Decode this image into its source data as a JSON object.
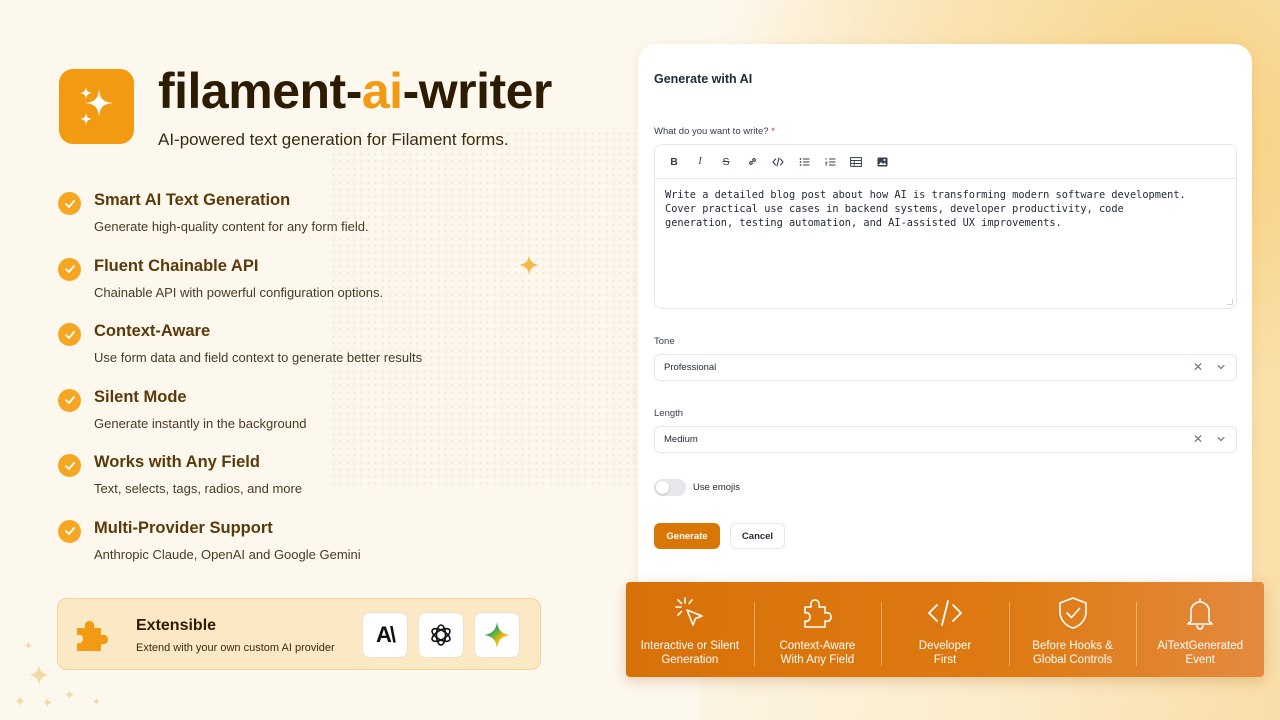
{
  "header": {
    "title_part1": "filament-",
    "title_part2": "ai",
    "title_part3": "-writer",
    "subtitle": "AI-powered text generation for Filament forms."
  },
  "features": [
    {
      "title": "Smart AI Text Generation",
      "desc": "Generate high-quality content for any form field."
    },
    {
      "title": "Fluent Chainable API",
      "desc": "Chainable API with powerful configuration options."
    },
    {
      "title": "Context-Aware",
      "desc": "Use form data and field context to generate better results"
    },
    {
      "title": "Silent Mode",
      "desc": "Generate instantly in the background"
    },
    {
      "title": "Works with Any Field",
      "desc": "Text, selects, tags, radios, and more"
    },
    {
      "title": "Multi-Provider Support",
      "desc": "Anthropic Claude, OpenAI and Google Gemini"
    }
  ],
  "extensible": {
    "title": "Extensible",
    "desc": "Extend with your own custom AI provider",
    "providers": [
      "anthropic-logo-icon",
      "openai-logo-icon",
      "gemini-logo-icon"
    ],
    "anthropic_label": "A\\"
  },
  "form": {
    "heading": "Generate with AI",
    "prompt_label": "What do you want to write?",
    "required_mark": "*",
    "prompt_value": "Write a detailed blog post about how AI is transforming modern software development.\nCover practical use cases in backend systems, developer productivity, code\ngeneration, testing automation, and AI-assisted UX improvements.",
    "toolbar": [
      "B",
      "I",
      "S",
      "link-icon",
      "code-icon",
      "bullet-list-icon",
      "ordered-list-icon",
      "table-icon",
      "image-icon"
    ],
    "tone_label": "Tone",
    "tone_value": "Professional",
    "length_label": "Length",
    "length_value": "Medium",
    "emoji_label": "Use emojis",
    "emoji_enabled": false,
    "clear_glyph": "✕",
    "generate_label": "Generate",
    "cancel_label": "Cancel"
  },
  "bottom_bar": [
    {
      "line1": "Interactive or Silent",
      "line2": "Generation",
      "icon": "cursor-click-icon"
    },
    {
      "line1": "Context-Aware",
      "line2": "With Any Field",
      "icon": "puzzle-icon"
    },
    {
      "line1": "Developer",
      "line2": "First",
      "icon": "code-icon"
    },
    {
      "line1": "Before Hooks &",
      "line2": "Global Controls",
      "icon": "shield-check-icon"
    },
    {
      "line1": "AiTextGenerated",
      "line2": "Event",
      "icon": "bell-icon"
    }
  ],
  "colors": {
    "accent": "#f29a12",
    "button": "#d97706",
    "background": "#fdf8ee",
    "feature_title": "#5a3a0a"
  }
}
